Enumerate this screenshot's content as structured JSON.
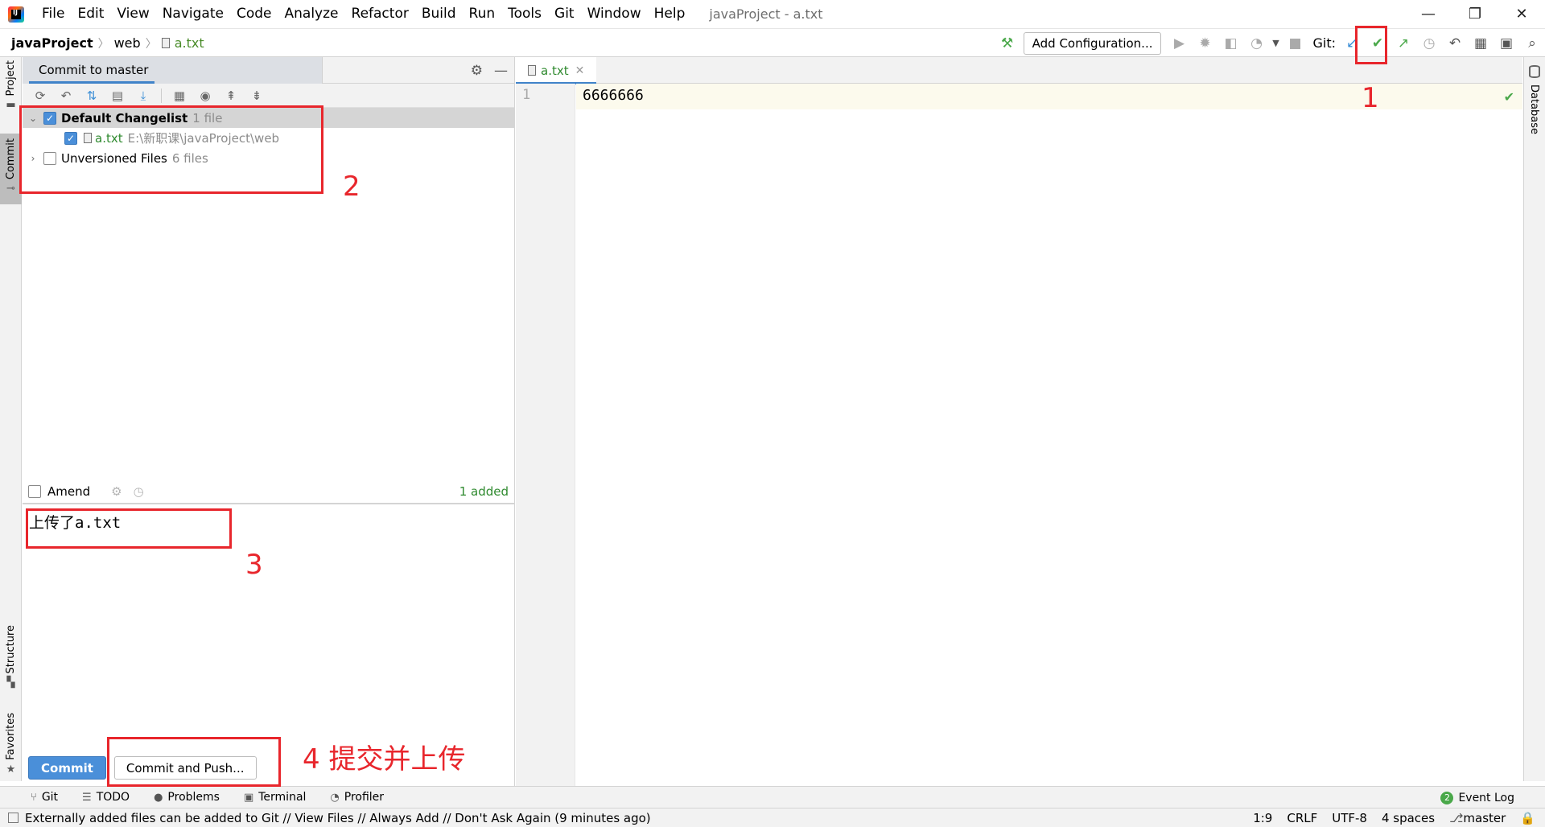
{
  "window": {
    "app_icon_text": "IJ",
    "menu": [
      "File",
      "Edit",
      "View",
      "Navigate",
      "Code",
      "Analyze",
      "Refactor",
      "Build",
      "Run",
      "Tools",
      "Git",
      "Window",
      "Help"
    ],
    "title": "javaProject - a.txt",
    "minimize": "—",
    "restore": "❐",
    "close": "✕"
  },
  "navbar": {
    "breadcrumbs": [
      "javaProject",
      "web",
      "a.txt"
    ],
    "add_configuration": "Add Configuration...",
    "git_label": "Git:"
  },
  "left_stripe": {
    "project": "Project",
    "commit": "Commit",
    "structure": "Structure",
    "favorites": "Favorites"
  },
  "right_stripe": {
    "database": "Database"
  },
  "commit_panel": {
    "tab_title": "Commit to master",
    "changelists": [
      {
        "name": "Default Changelist",
        "count": "1 file",
        "checked": true,
        "expanded": true
      },
      {
        "name": "Unversioned Files",
        "count": "6 files",
        "checked": false,
        "expanded": false
      }
    ],
    "file": {
      "name": "a.txt",
      "path": "E:\\新职课\\javaProject\\web",
      "checked": true
    },
    "amend_label": "Amend",
    "added_count": "1 added",
    "commit_message": "上传了a.txt",
    "commit_button": "Commit",
    "commit_push_button": "Commit and Push..."
  },
  "editor": {
    "tab_name": "a.txt",
    "line_number": "1",
    "content": "6666666"
  },
  "bottom_tools": [
    "Git",
    "TODO",
    "Problems",
    "Terminal",
    "Profiler"
  ],
  "event_log": {
    "badge": "2",
    "label": "Event Log"
  },
  "statusbar": {
    "message": "Externally added files can be added to Git // View Files // Always Add // Don't Ask Again (9 minutes ago)",
    "position": "1:9",
    "line_separator": "CRLF",
    "encoding": "UTF-8",
    "indent": "4 spaces",
    "branch": "master"
  },
  "annotations": {
    "n1": "1",
    "n2": "2",
    "n3": "3",
    "n4": "4 提交并上传",
    "color": "#e8262c"
  },
  "icons": {
    "toolbar": [
      "build-hammer-icon",
      "run-icon",
      "debug-icon",
      "coverage-icon",
      "profile-icon",
      "stop-icon",
      "git-update-icon",
      "git-commit-icon",
      "git-push-icon",
      "git-history-icon",
      "git-rollback-icon",
      "project-structure-icon",
      "presentation-icon",
      "search-icon"
    ],
    "commit_toolbar": [
      "refresh-icon",
      "rollback-icon",
      "update-icon",
      "diff-icon",
      "shelve-icon",
      "group-by-icon",
      "view-options-icon",
      "expand-all-icon",
      "collapse-all-icon"
    ]
  }
}
